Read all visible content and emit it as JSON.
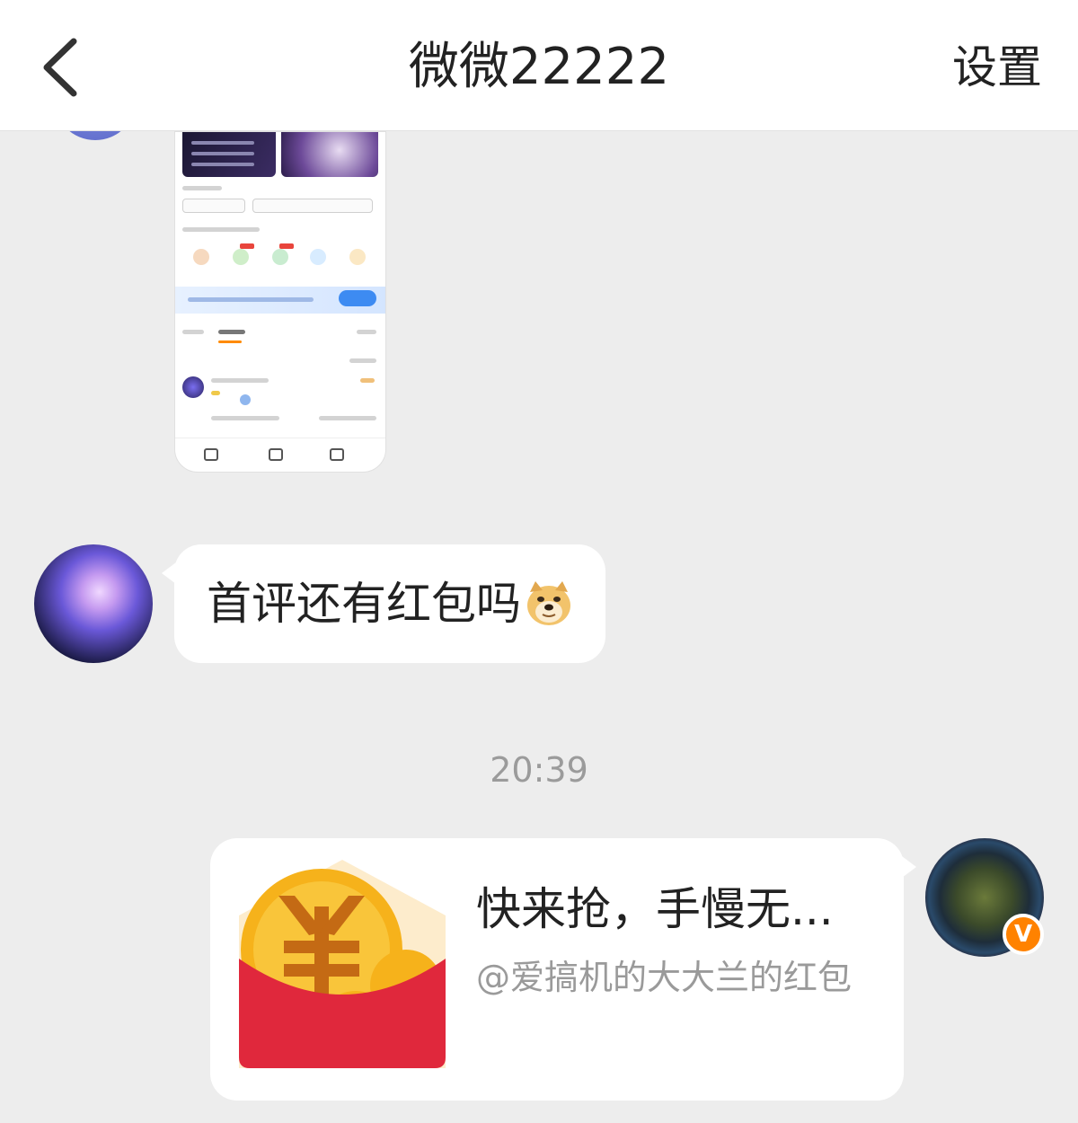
{
  "header": {
    "title": "微微22222",
    "settings_label": "设置",
    "back_icon": "chevron-left-icon"
  },
  "messages": [
    {
      "type": "image",
      "sender": "other",
      "description_icon": "shared-screenshot-image"
    },
    {
      "type": "text",
      "sender": "other",
      "text": "首评还有红包吗",
      "emoji": "doge-emoji"
    },
    {
      "type": "timestamp",
      "text": "20:39"
    },
    {
      "type": "red_packet",
      "sender": "self",
      "title": "快来抢，手慢无...",
      "subtitle": "@爱搞机的大大兰的红包",
      "verified_badge": "V"
    }
  ],
  "colors": {
    "background": "#ededed",
    "bubble": "#ffffff",
    "timestamp": "#9b9b9b",
    "packet_red": "#e0283c",
    "coin_gold": "#f6b21b",
    "verified_orange": "#ff8200"
  }
}
